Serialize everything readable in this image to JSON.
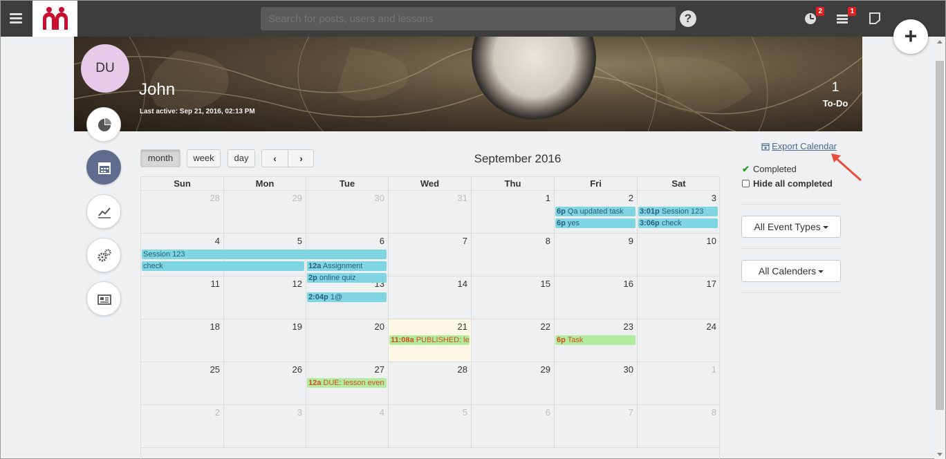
{
  "topbar": {
    "search_placeholder": "Search for posts, users and lessons",
    "help_label": "?",
    "notifications_badge": "2",
    "tasks_badge": "1",
    "fab_label": "+"
  },
  "profile": {
    "initials": "DU",
    "name": "John",
    "last_active": "Last active: Sep 21, 2016, 02:13 PM",
    "todo_count": "1",
    "todo_label": "To-Do"
  },
  "side_nav": [
    {
      "name": "analytics-pie",
      "icon": "pie-chart-icon",
      "active": false
    },
    {
      "name": "calendar",
      "icon": "calendar-icon",
      "active": true
    },
    {
      "name": "progress",
      "icon": "trend-line-icon",
      "active": false
    },
    {
      "name": "settings",
      "icon": "gears-icon",
      "active": false
    },
    {
      "name": "news",
      "icon": "newspaper-icon",
      "active": false
    }
  ],
  "calendar": {
    "views": [
      "month",
      "week",
      "day"
    ],
    "active_view": "month",
    "prev_label": "‹",
    "next_label": "›",
    "title": "September 2016",
    "weekdays": [
      "Sun",
      "Mon",
      "Tue",
      "Wed",
      "Thu",
      "Fri",
      "Sat"
    ],
    "weeks": [
      [
        {
          "d": "28",
          "other": true
        },
        {
          "d": "29",
          "other": true
        },
        {
          "d": "30",
          "other": true
        },
        {
          "d": "31",
          "other": true
        },
        {
          "d": "1"
        },
        {
          "d": "2"
        },
        {
          "d": "3"
        }
      ],
      [
        {
          "d": "4"
        },
        {
          "d": "5"
        },
        {
          "d": "6"
        },
        {
          "d": "7"
        },
        {
          "d": "8"
        },
        {
          "d": "9"
        },
        {
          "d": "10"
        }
      ],
      [
        {
          "d": "11"
        },
        {
          "d": "12"
        },
        {
          "d": "13"
        },
        {
          "d": "14"
        },
        {
          "d": "15"
        },
        {
          "d": "16"
        },
        {
          "d": "17"
        }
      ],
      [
        {
          "d": "18"
        },
        {
          "d": "19"
        },
        {
          "d": "20"
        },
        {
          "d": "21",
          "today": true
        },
        {
          "d": "22"
        },
        {
          "d": "23"
        },
        {
          "d": "24"
        }
      ],
      [
        {
          "d": "25"
        },
        {
          "d": "26"
        },
        {
          "d": "27"
        },
        {
          "d": "28"
        },
        {
          "d": "29"
        },
        {
          "d": "30"
        },
        {
          "d": "1",
          "other": true
        }
      ],
      [
        {
          "d": "2",
          "other": true
        },
        {
          "d": "3",
          "other": true
        },
        {
          "d": "4",
          "other": true
        },
        {
          "d": "5",
          "other": true
        },
        {
          "d": "6",
          "other": true
        },
        {
          "d": "7",
          "other": true
        },
        {
          "d": "8",
          "other": true
        }
      ]
    ],
    "events": [
      {
        "week": 0,
        "col": 5,
        "span": 1,
        "slot": 0,
        "time": "6p",
        "title": "Qa updated task",
        "color": "cyan"
      },
      {
        "week": 0,
        "col": 5,
        "span": 1,
        "slot": 1,
        "time": "6p",
        "title": "yes",
        "color": "cyan"
      },
      {
        "week": 0,
        "col": 6,
        "span": 1,
        "slot": 0,
        "time": "3:01p",
        "title": "Session 123",
        "color": "cyan"
      },
      {
        "week": 0,
        "col": 6,
        "span": 1,
        "slot": 1,
        "time": "3:06p",
        "title": "check",
        "color": "cyan"
      },
      {
        "week": 1,
        "col": 0,
        "span": 3,
        "slot": 0,
        "time": "",
        "title": "Session 123",
        "color": "cyan"
      },
      {
        "week": 1,
        "col": 0,
        "span": 2,
        "slot": 1,
        "time": "",
        "title": "check",
        "color": "cyan"
      },
      {
        "week": 1,
        "col": 2,
        "span": 1,
        "slot": 1,
        "time": "12a",
        "title": "Assignment",
        "color": "cyan"
      },
      {
        "week": 1,
        "col": 2,
        "span": 1,
        "slot": 2,
        "time": "2p",
        "title": "online quiz",
        "color": "cyan"
      },
      {
        "week": 2,
        "col": 2,
        "span": 1,
        "slot": 0,
        "time": "2:04p",
        "title": "1@",
        "color": "cyan"
      },
      {
        "week": 3,
        "col": 3,
        "span": 1,
        "slot": 0,
        "time": "11:08a",
        "title": "PUBLISHED: le",
        "color": "green"
      },
      {
        "week": 3,
        "col": 5,
        "span": 1,
        "slot": 0,
        "time": "6p",
        "title": "Task",
        "color": "green"
      },
      {
        "week": 4,
        "col": 2,
        "span": 1,
        "slot": 0,
        "time": "12a",
        "title": "DUE: lesson even",
        "color": "green"
      }
    ]
  },
  "right_panel": {
    "export_label": "Export Calendar",
    "completed_label": "Completed",
    "hide_completed_label": "Hide all completed",
    "event_types_label": "All Event Types",
    "calendars_label": "All Calenders"
  }
}
